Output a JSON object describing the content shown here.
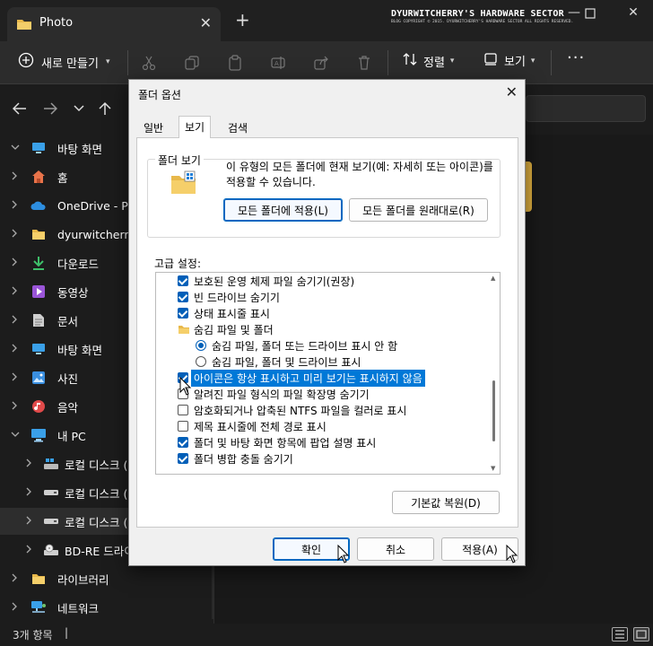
{
  "explorer": {
    "tab_title": "Photo",
    "watermark_title": "DYURWITCHERRY'S HARDWARE SECTOR",
    "watermark_sub": "BLOG COPYRIGHT © 2015. DYURWITCHERRY'S HARDWARE SECTOR ALL RIGHTS RESERVED.",
    "new_label": "새로 만들기",
    "sort_label": "정렬",
    "view_label": "보기",
    "more_label": "···",
    "status_count": "3개 항목",
    "sidebar": [
      {
        "label": "바탕 화면",
        "icon": "desktop-icon",
        "color": "#3aa0e8"
      },
      {
        "label": "홈",
        "icon": "home-icon",
        "color": "#e8734a"
      },
      {
        "label": "OneDrive - Pe",
        "icon": "cloud-icon",
        "color": "#2d8ee0"
      },
      {
        "label": "dyurwitcherry",
        "icon": "folder-icon",
        "color": "#e8b84a"
      },
      {
        "label": "다운로드",
        "icon": "download-icon",
        "color": "#3ec06a"
      },
      {
        "label": "동영상",
        "icon": "video-icon",
        "color": "#9a55d8"
      },
      {
        "label": "문서",
        "icon": "document-icon",
        "color": "#cfcfcf"
      },
      {
        "label": "바탕 화면",
        "icon": "desktop-icon",
        "color": "#3aa0e8"
      },
      {
        "label": "사진",
        "icon": "picture-icon",
        "color": "#3a8fe0"
      },
      {
        "label": "음악",
        "icon": "music-icon",
        "color": "#e04a4a"
      },
      {
        "label": "내 PC",
        "icon": "pc-icon",
        "color": "#3aa0e8"
      },
      {
        "label": "로컬 디스크 (",
        "icon": "windows-drive-icon",
        "color": "#3aa0e8"
      },
      {
        "label": "로컬 디스크 (",
        "icon": "drive-icon",
        "color": "#cfcfcf"
      },
      {
        "label": "로컬 디스크 (",
        "icon": "drive-icon",
        "color": "#cfcfcf"
      },
      {
        "label": "BD-RE 드라이",
        "icon": "optical-drive-icon",
        "color": "#cfcfcf"
      },
      {
        "label": "라이브러리",
        "icon": "folder-icon",
        "color": "#e8b84a"
      },
      {
        "label": "네트워크",
        "icon": "network-icon",
        "color": "#3aa0e8"
      }
    ]
  },
  "dialog": {
    "title": "폴더 옵션",
    "tabs": [
      "일반",
      "보기",
      "검색"
    ],
    "folder_view_legend": "폴더 보기",
    "folder_view_text": "이 유형의 모든 폴더에 현재 보기(예: 자세히 또는 아이콘)를 적용할 수 있습니다.",
    "apply_to_folders": "모든 폴더에 적용(L)",
    "reset_folders": "모든 폴더를 원래대로(R)",
    "advanced_label": "고급 설정:",
    "advanced_items": [
      {
        "type": "check",
        "checked": true,
        "indent": 0,
        "label": "보호된 운영 체제 파일 숨기기(권장)"
      },
      {
        "type": "check",
        "checked": true,
        "indent": 0,
        "label": "빈 드라이브 숨기기"
      },
      {
        "type": "check",
        "checked": true,
        "indent": 0,
        "label": "상태 표시줄 표시"
      },
      {
        "type": "folder",
        "checked": false,
        "indent": 0,
        "label": "숨김 파일 및 폴더"
      },
      {
        "type": "radio",
        "checked": true,
        "indent": 1,
        "label": "숨김 파일, 폴더 또는 드라이브 표시 안 함"
      },
      {
        "type": "radio",
        "checked": false,
        "indent": 1,
        "label": "숨김 파일, 폴더 및 드라이브 표시"
      },
      {
        "type": "check",
        "checked": true,
        "indent": 0,
        "label": "아이콘은 항상 표시하고 미리 보기는 표시하지 않음",
        "highlight": true
      },
      {
        "type": "check",
        "checked": false,
        "indent": 0,
        "label": "알려진 파일 형식의 파일 확장명 숨기기"
      },
      {
        "type": "check",
        "checked": false,
        "indent": 0,
        "label": "암호화되거나 압축된 NTFS 파일을 컬러로 표시"
      },
      {
        "type": "check",
        "checked": false,
        "indent": 0,
        "label": "제목 표시줄에 전체 경로 표시"
      },
      {
        "type": "check",
        "checked": true,
        "indent": 0,
        "label": "폴더 및 바탕 화면 항목에 팝업 설명 표시"
      },
      {
        "type": "check",
        "checked": true,
        "indent": 0,
        "label": "폴더 병합 충돌 숨기기"
      }
    ],
    "restore_defaults": "기본값 복원(D)",
    "ok": "확인",
    "cancel": "취소",
    "apply": "적용(A)"
  },
  "colors": {
    "accent": "#005fb8",
    "highlight": "#0078d7",
    "folder": "#e8b84a"
  }
}
